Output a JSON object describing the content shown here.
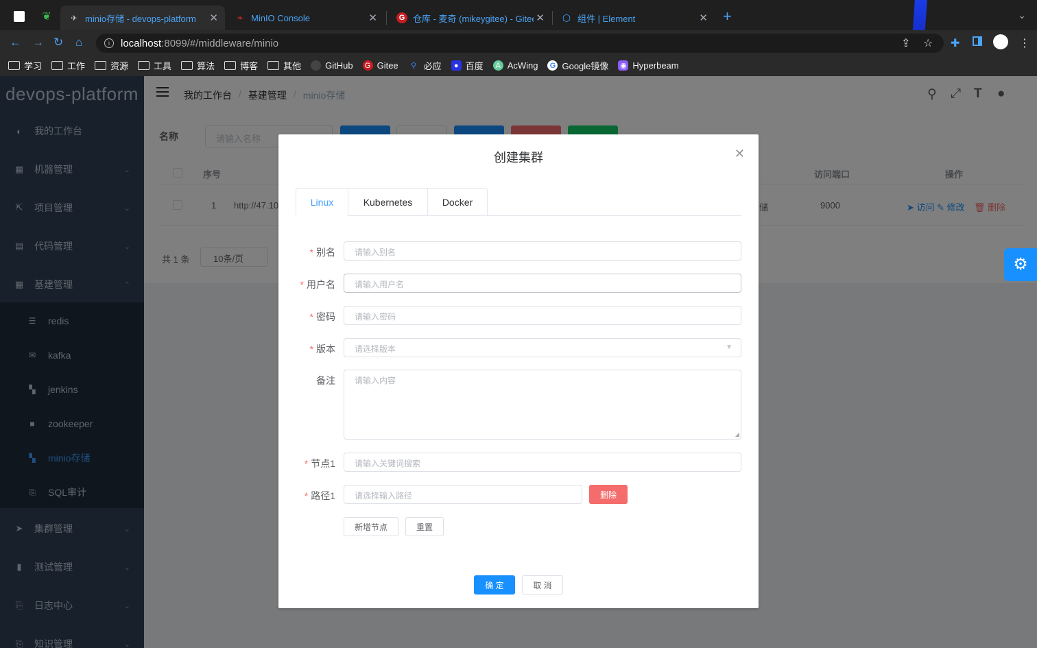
{
  "browser": {
    "tabs": [
      {
        "title": "minio存储 - devops-platform",
        "active": true
      },
      {
        "title": "MinIO Console"
      },
      {
        "title": "仓库 - 麦奇 (mikeygitee) - Gitee"
      },
      {
        "title": "组件 | Element"
      }
    ],
    "url_host": "localhost",
    "url_path": ":8099/#/middleware/minio",
    "bookmarks": [
      "学习",
      "工作",
      "资源",
      "工具",
      "算法",
      "博客",
      "其他",
      "GitHub",
      "Gitee",
      "必应",
      "百度",
      "AcWing",
      "Google镜像",
      "Hyperbeam"
    ]
  },
  "sidebar": {
    "logo": "devops-platform",
    "items": [
      {
        "label": "我的工作台",
        "icon": "dashboard-icon"
      },
      {
        "label": "机器管理",
        "icon": "grid-icon"
      },
      {
        "label": "项目管理",
        "icon": "external-link-icon"
      },
      {
        "label": "代码管理",
        "icon": "document-icon"
      },
      {
        "label": "基建管理",
        "icon": "table-icon"
      }
    ],
    "sub_items": [
      {
        "label": "redis",
        "icon": "list-icon"
      },
      {
        "label": "kafka",
        "icon": "mail-icon"
      },
      {
        "label": "jenkins",
        "icon": "apps-icon"
      },
      {
        "label": "zookeeper",
        "icon": "lock-icon"
      },
      {
        "label": "minio存储",
        "icon": "apps-icon"
      },
      {
        "label": "SQL审计",
        "icon": "audit-icon"
      }
    ],
    "lower_items": [
      {
        "label": "集群管理",
        "icon": "send-icon"
      },
      {
        "label": "测试管理",
        "icon": "bar-chart-icon"
      },
      {
        "label": "日志中心",
        "icon": "log-icon"
      },
      {
        "label": "知识管理",
        "icon": "book-icon"
      }
    ]
  },
  "navbar": {
    "breadcrumb": [
      "我的工作台",
      "基建管理",
      "minio存储"
    ]
  },
  "content": {
    "search_label": "名称",
    "search_placeholder": "请输入名称",
    "columns": [
      "序号",
      "访问端口",
      "操作"
    ],
    "row": {
      "index": "1",
      "url": "http://47.10",
      "name_tail": "储",
      "port": "9000",
      "visit": "访问",
      "edit": "修改",
      "delete": "删除"
    },
    "total": "共 1 条",
    "page_size": "10条/页"
  },
  "dialog": {
    "title": "创建集群",
    "tabs": [
      "Linux",
      "Kubernetes",
      "Docker"
    ],
    "fields": {
      "alias": {
        "label": "别名",
        "placeholder": "请输入别名"
      },
      "username": {
        "label": "用户名",
        "placeholder": "请输入用户名"
      },
      "password": {
        "label": "密码",
        "placeholder": "请输入密码"
      },
      "version": {
        "label": "版本",
        "placeholder": "请选择版本"
      },
      "remark": {
        "label": "备注",
        "placeholder": "请输入内容"
      },
      "node1": {
        "label": "节点1",
        "placeholder": "请输入关键词搜索"
      },
      "path1": {
        "label": "路径1",
        "placeholder": "请选择输入路径"
      }
    },
    "delete_btn": "删除",
    "add_node_btn": "新增节点",
    "reset_btn": "重置",
    "confirm_btn": "确 定",
    "cancel_btn": "取 消"
  },
  "colors": {
    "primary": "#1890ff",
    "danger": "#f56c6c",
    "sidebar_bg": "#304156",
    "sidebar_sub_bg": "#1f2d3d"
  }
}
